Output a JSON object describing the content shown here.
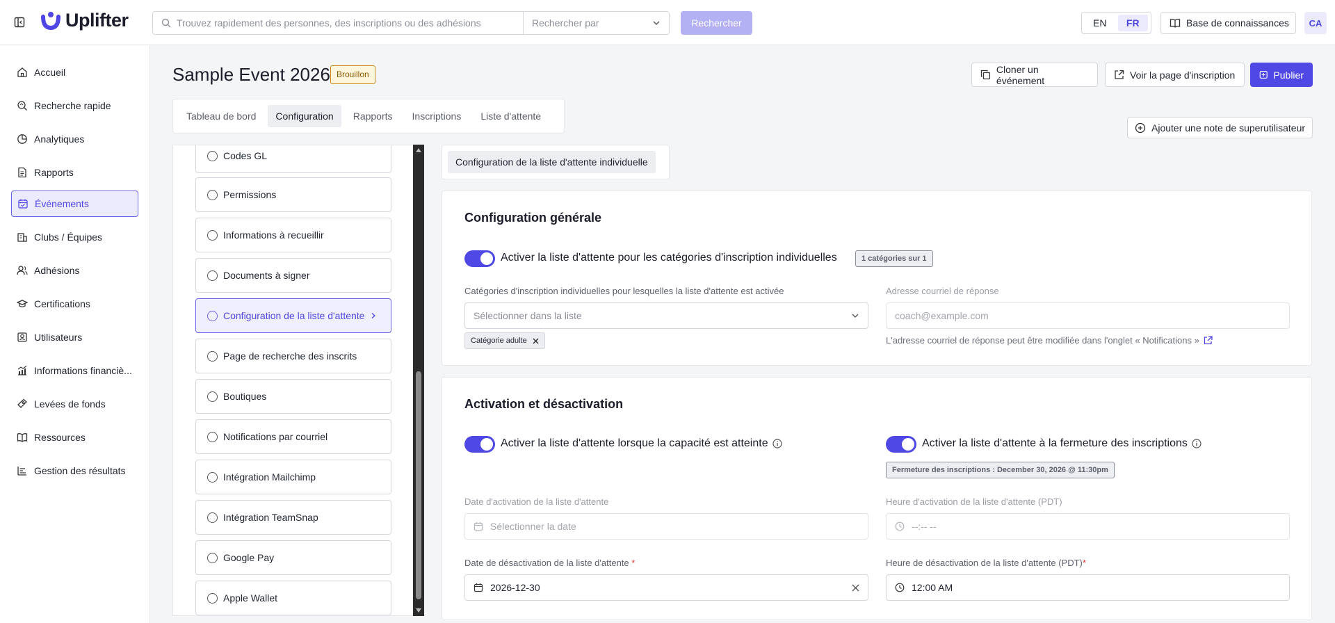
{
  "app": {
    "name": "Uplifter"
  },
  "search": {
    "placeholder": "Trouvez rapidement des personnes, des inscriptions ou des adhésions",
    "search_by": "Rechercher par",
    "button": "Rechercher"
  },
  "lang": {
    "en": "EN",
    "fr": "FR",
    "active": "FR"
  },
  "header_links": {
    "knowledge_base": "Base de connaissances",
    "avatar": "CA"
  },
  "sidebar": {
    "items": [
      {
        "label": "Accueil",
        "icon": "home-icon"
      },
      {
        "label": "Recherche rapide",
        "icon": "search-icon"
      },
      {
        "label": "Analytiques",
        "icon": "pie-chart-icon"
      },
      {
        "label": "Rapports",
        "icon": "document-icon"
      },
      {
        "label": "Événements",
        "icon": "calendar-icon",
        "active": true
      },
      {
        "label": "Clubs / Équipes",
        "icon": "building-icon"
      },
      {
        "label": "Adhésions",
        "icon": "users-icon"
      },
      {
        "label": "Certifications",
        "icon": "graduation-cap-icon"
      },
      {
        "label": "Utilisateurs",
        "icon": "user-card-icon"
      },
      {
        "label": "Informations financiè...",
        "icon": "finance-chart-icon"
      },
      {
        "label": "Levées de fonds",
        "icon": "fundraising-icon"
      },
      {
        "label": "Ressources",
        "icon": "book-icon"
      },
      {
        "label": "Gestion des résultats",
        "icon": "bar-chart-icon"
      }
    ]
  },
  "event": {
    "title": "Sample Event 2026",
    "status": "Brouillon",
    "actions": {
      "clone": "Cloner un événement",
      "view_page": "Voir la page d'inscription",
      "publish": "Publier"
    },
    "tabs": [
      "Tableau de bord",
      "Configuration",
      "Rapports",
      "Inscriptions",
      "Liste d'attente"
    ],
    "active_tab": "Configuration",
    "superuser_note": "Ajouter une note de superutilisateur"
  },
  "settings_list": {
    "items": [
      "Codes GL",
      "Permissions",
      "Informations à recueillir",
      "Documents à signer",
      "Configuration de la liste d'attente",
      "Page de recherche des inscrits",
      "Boutiques",
      "Notifications par courriel",
      "Intégration Mailchimp",
      "Intégration TeamSnap",
      "Google Pay",
      "Apple Wallet"
    ],
    "active": "Configuration de la liste d'attente"
  },
  "subtab": "Configuration de la liste d'attente individuelle",
  "general": {
    "title": "Configuration générale",
    "toggle_label": "Activer la liste d'attente pour les catégories d'inscription individuelles",
    "toggle_on": true,
    "count_chip": "1 catégories sur 1",
    "categories_label": "Catégories d'inscription individuelles pour lesquelles la liste d'attente est activée",
    "categories_placeholder": "Sélectionner dans la liste",
    "selected_tag": "Catégorie adulte",
    "reply_email_label": "Adresse courriel de réponse",
    "reply_email_placeholder": "coach@example.com",
    "reply_email_help": "L'adresse courriel de réponse peut être modifiée dans l'onglet « Notifications »"
  },
  "activation": {
    "title": "Activation et désactivation",
    "capacity_toggle": "Activer la liste d'attente lorsque la capacité est atteinte",
    "capacity_on": true,
    "closing_toggle": "Activer la liste d'attente à la fermeture des inscriptions",
    "closing_on": true,
    "closing_chip": "Fermeture des inscriptions : December 30, 2026 @ 11:30pm",
    "activation_date_label": "Date d'activation de la liste d'attente",
    "activation_date_placeholder": "Sélectionner la date",
    "activation_time_label": "Heure d'activation de la liste d'attente (PDT)",
    "activation_time_placeholder": "--:-- --",
    "deactivation_date_label": "Date de désactivation de la liste d'attente",
    "deactivation_date_value": "2026-12-30",
    "deactivation_time_label": "Heure de désactivation de la liste d'attente (PDT)",
    "deactivation_time_value": "12:00 AM",
    "required_mark": "*"
  },
  "colors": {
    "accent": "#5048e5",
    "draft_badge": "#c58a15"
  }
}
